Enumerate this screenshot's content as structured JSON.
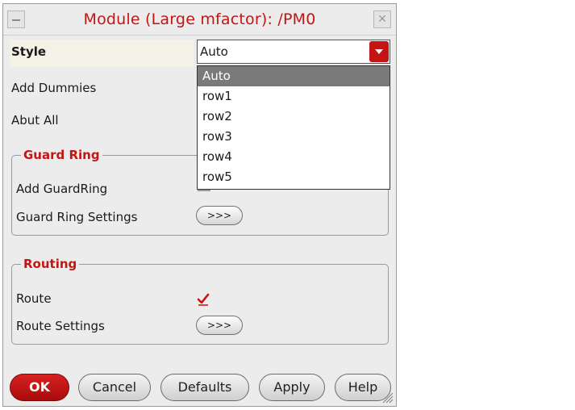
{
  "window": {
    "title": "Module (Large mfactor): /PM0",
    "close_glyph": "✕"
  },
  "style": {
    "label": "Style",
    "value": "Auto",
    "options": [
      "Auto",
      "row1",
      "row2",
      "row3",
      "row4",
      "row5"
    ],
    "selected_index": 0
  },
  "add_dummies": {
    "label": "Add Dummies"
  },
  "abut_all": {
    "label": "Abut All"
  },
  "guard_ring": {
    "title": "Guard Ring",
    "add_label": "Add GuardRing",
    "add_checked": false,
    "settings_label": "Guard Ring Settings",
    "settings_button": ">>>"
  },
  "routing": {
    "title": "Routing",
    "route_label": "Route",
    "route_checked": true,
    "settings_label": "Route Settings",
    "settings_button": ">>>"
  },
  "buttons": {
    "ok": "OK",
    "cancel": "Cancel",
    "defaults": "Defaults",
    "apply": "Apply",
    "help": "Help"
  },
  "colors": {
    "accent": "#c41414",
    "dialog_bg": "#ececec",
    "selected_row": "#7a7a7a"
  }
}
